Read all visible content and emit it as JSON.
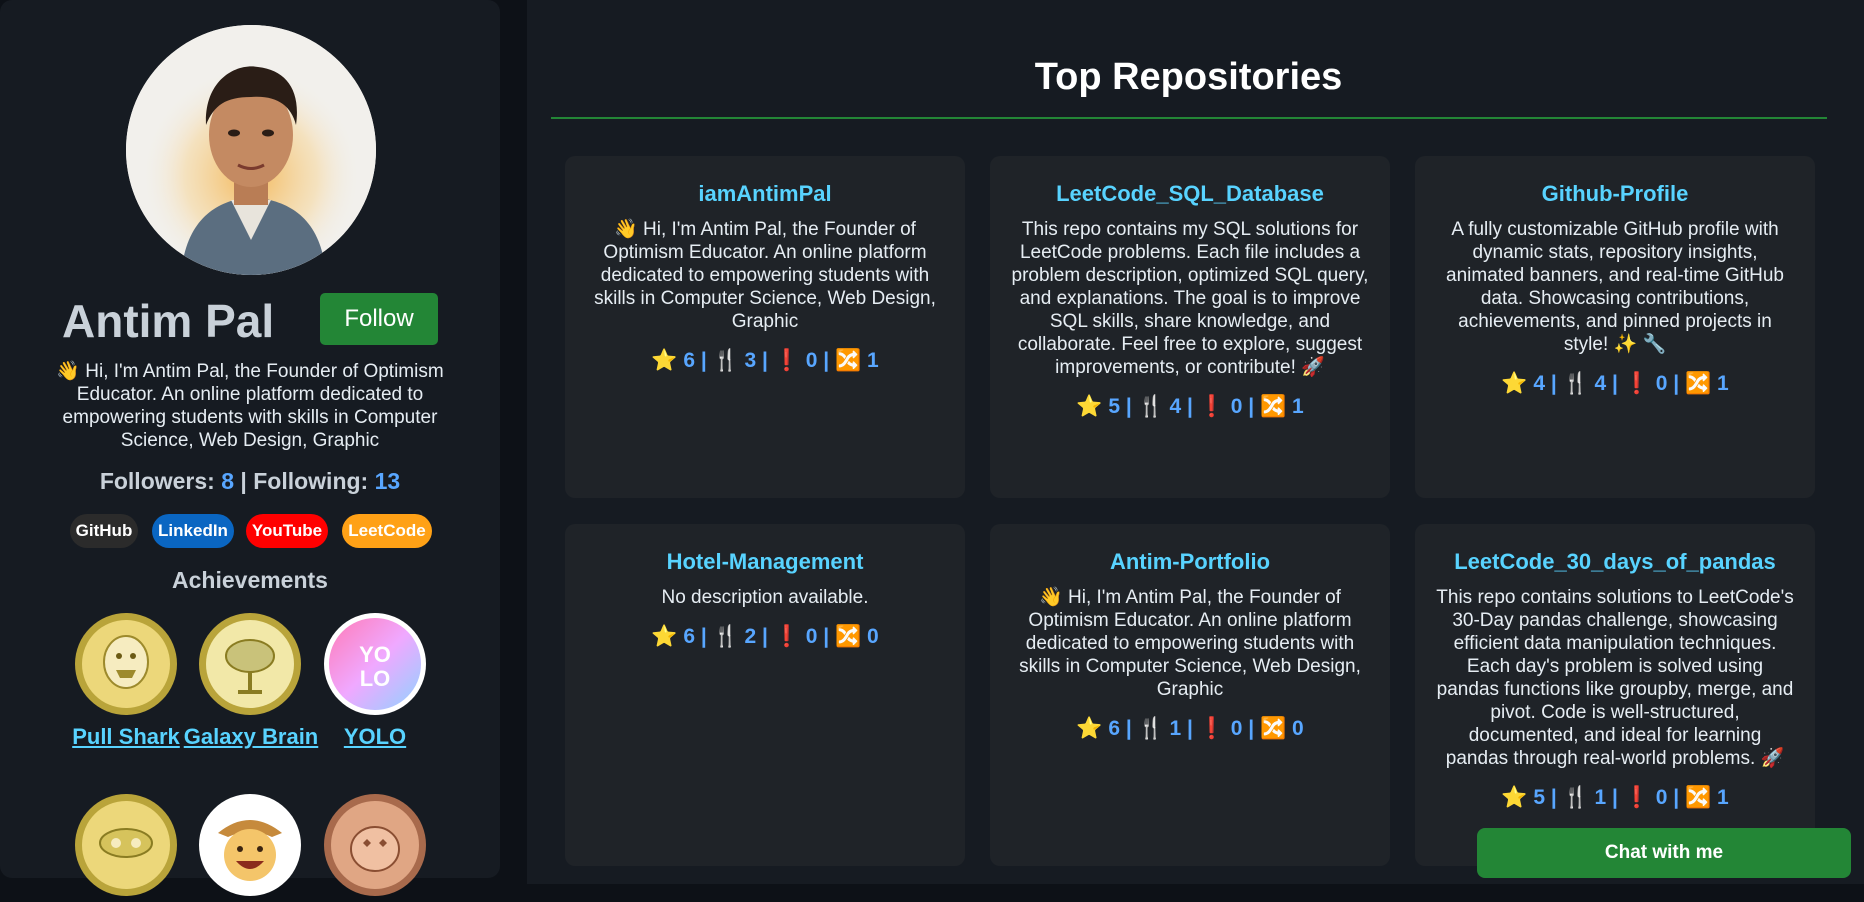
{
  "profile": {
    "name": "Antim Pal",
    "follow_label": "Follow",
    "bio": "👋 Hi, I'm Antim Pal, the Founder of Optimism Educator. An online platform dedicated to empowering students with skills in Computer Science, Web Design, Graphic",
    "followers_label": "Followers:",
    "followers": "8",
    "following_label": "Following:",
    "following": "13",
    "separator": "|"
  },
  "socials": [
    {
      "label": "GitHub",
      "color": "#2b2b2b"
    },
    {
      "label": "LinkedIn",
      "color": "#0a66c2"
    },
    {
      "label": "YouTube",
      "color": "#ff0000"
    },
    {
      "label": "LeetCode",
      "color": "#ffa116"
    }
  ],
  "achievements": {
    "title": "Achievements",
    "badges": [
      {
        "name": "Pull Shark",
        "icon": "pull-shark-icon"
      },
      {
        "name": "Galaxy Brain",
        "icon": "galaxy-brain-icon"
      },
      {
        "name": "YOLO",
        "icon": "yolo-icon"
      },
      {
        "name": "",
        "icon": "pair-extraordinaire-icon"
      },
      {
        "name": "",
        "icon": "starstruck-cowboy-icon"
      },
      {
        "name": "",
        "icon": "quickdraw-icon"
      }
    ]
  },
  "main": {
    "title": "Top Repositories",
    "repos": [
      {
        "name": "iamAntimPal",
        "desc": "👋 Hi, I'm Antim Pal, the Founder of Optimism Educator. An online platform dedicated to empowering students with skills in Computer Science, Web Design, Graphic",
        "stats": "⭐ 6 | 🍴 3 | ❗ 0 | 🔀 1"
      },
      {
        "name": "LeetCode_SQL_Database",
        "desc": "This repo contains my SQL solutions for LeetCode problems. Each file includes a problem description, optimized SQL query, and explanations. The goal is to improve SQL skills, share knowledge, and collaborate. Feel free to explore, suggest improvements, or contribute! 🚀",
        "stats": "⭐ 5 | 🍴 4 | ❗ 0 | 🔀 1"
      },
      {
        "name": "Github-Profile",
        "desc": "A fully customizable GitHub profile with dynamic stats, repository insights, animated banners, and real-time GitHub data. Showcasing contributions, achievements, and pinned projects in style! ✨ 🔧",
        "stats": "⭐ 4 | 🍴 4 | ❗ 0 | 🔀 1"
      },
      {
        "name": "Hotel-Management",
        "desc": "No description available.",
        "stats": "⭐ 6 | 🍴 2 | ❗ 0 | 🔀 0"
      },
      {
        "name": "Antim-Portfolio",
        "desc": "👋 Hi, I'm Antim Pal, the Founder of Optimism Educator. An online platform dedicated to empowering students with skills in Computer Science, Web Design, Graphic",
        "stats": "⭐ 6 | 🍴 1 | ❗ 0 | 🔀 0"
      },
      {
        "name": "LeetCode_30_days_of_pandas",
        "desc": "This repo contains solutions to LeetCode's 30-Day pandas challenge, showcasing efficient data manipulation techniques. Each day's problem is solved using pandas functions like groupby, merge, and pivot. Code is well-structured, documented, and ideal for learning pandas through real-world problems. 🚀",
        "stats": "⭐ 5 | 🍴 1 | ❗ 0 | 🔀 1"
      }
    ]
  },
  "chat": {
    "label": "Chat with me"
  }
}
